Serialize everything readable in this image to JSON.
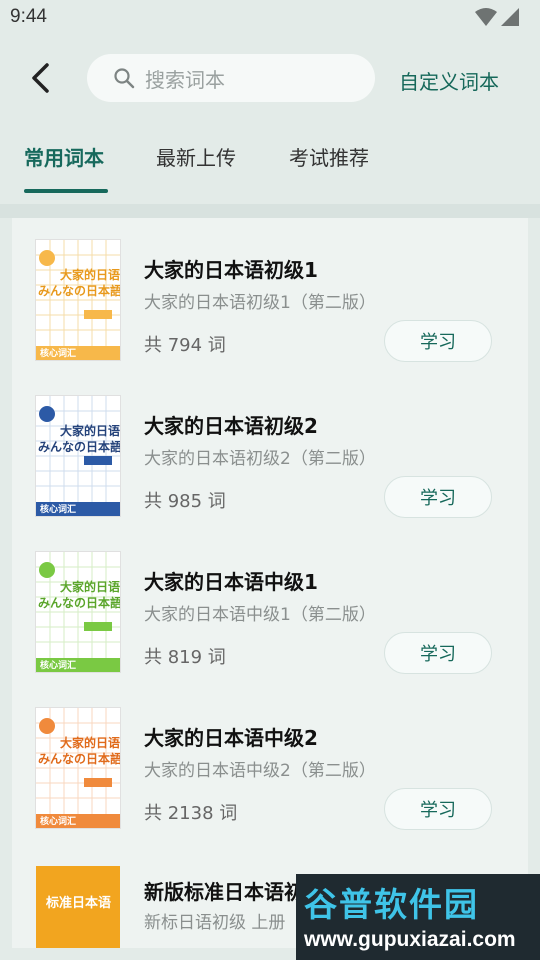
{
  "status_bar": {
    "time": "9:44"
  },
  "header": {
    "search_placeholder": "搜索词本",
    "custom_label": "自定义词本"
  },
  "tabs": [
    {
      "label": "常用词本",
      "active": true
    },
    {
      "label": "最新上传",
      "active": false
    },
    {
      "label": "考试推荐",
      "active": false
    }
  ],
  "books": [
    {
      "title": "大家的日本语初级1",
      "subtitle": "大家的日本语初级1（第二版）",
      "count_text": "共 794 词",
      "button": "学习",
      "cover": {
        "line1": "大家的日语",
        "line2": "みんなの日本語",
        "footer": "核心词汇",
        "accent": "#f7b84a",
        "text_color": "#e8991c"
      }
    },
    {
      "title": "大家的日本语初级2",
      "subtitle": "大家的日本语初级2（第二版）",
      "count_text": "共 985 词",
      "button": "学习",
      "cover": {
        "line1": "大家的日语",
        "line2": "みんなの日本語",
        "footer": "核心词汇",
        "accent": "#2c5aa6",
        "text_color": "#24427a"
      }
    },
    {
      "title": "大家的日本语中级1",
      "subtitle": "大家的日本语中级1（第二版）",
      "count_text": "共 819 词",
      "button": "学习",
      "cover": {
        "line1": "大家的日语",
        "line2": "みんなの日本語",
        "footer": "核心词汇",
        "accent": "#7ac943",
        "text_color": "#5aa52a"
      }
    },
    {
      "title": "大家的日本语中级2",
      "subtitle": "大家的日本语中级2（第二版）",
      "count_text": "共 2138 词",
      "button": "学习",
      "cover": {
        "line1": "大家的日语",
        "line2": "みんなの日本語",
        "footer": "核心词汇",
        "accent": "#f08a3c",
        "text_color": "#e06a1a"
      }
    },
    {
      "title": "新版标准日本语初级 上册",
      "subtitle": "新标日语初级 上册",
      "count_text": "",
      "button": "",
      "cover": {
        "line1": "标准日本语",
        "line2": "",
        "footer": "",
        "accent": "#f2a51f",
        "text_color": "#ffffff"
      }
    }
  ],
  "watermark": {
    "title": "谷普软件园",
    "url": "www.gupuxiazai.com"
  },
  "colors": {
    "accent": "#17695c",
    "background": "#e3ebe8"
  }
}
